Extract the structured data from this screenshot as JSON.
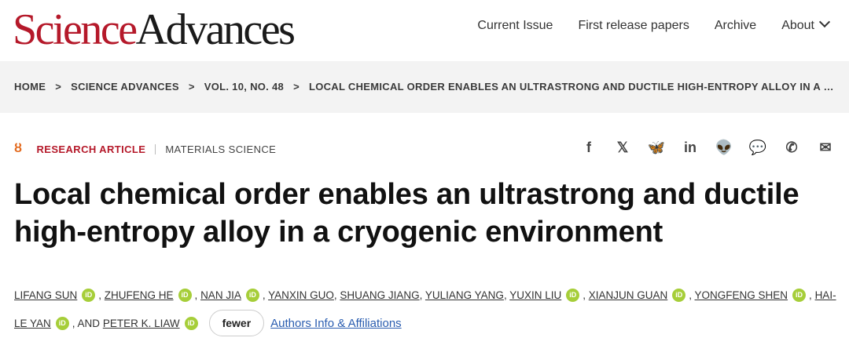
{
  "logo": {
    "science": "Science",
    "advances": "Advances"
  },
  "nav": {
    "current_issue": "Current Issue",
    "first_release": "First release papers",
    "archive": "Archive",
    "about": "About"
  },
  "breadcrumb": {
    "home": "HOME",
    "journal": "SCIENCE ADVANCES",
    "issue": "VOL. 10, NO. 48",
    "article": "LOCAL CHEMICAL ORDER ENABLES AN ULTRASTRONG AND DUCTILE HIGH-ENTROPY ALLOY IN A CRYOGENIC ENVIRONMENT",
    "separator": ">"
  },
  "article": {
    "access_icon": "open-access-icon",
    "type": "RESEARCH ARTICLE",
    "subject": "MATERIALS SCIENCE",
    "title": "Local chemical order enables an ultrastrong and ductile high-entropy alloy in a cryogenic environment"
  },
  "share": [
    {
      "name": "facebook-icon",
      "glyph": "f"
    },
    {
      "name": "x-icon",
      "glyph": "𝕏"
    },
    {
      "name": "bluesky-icon",
      "glyph": "🦋"
    },
    {
      "name": "linkedin-icon",
      "glyph": "in"
    },
    {
      "name": "reddit-icon",
      "glyph": "👽"
    },
    {
      "name": "wechat-icon",
      "glyph": "💬"
    },
    {
      "name": "whatsapp-icon",
      "glyph": "✆"
    },
    {
      "name": "email-icon",
      "glyph": "✉"
    }
  ],
  "authors": [
    {
      "name": "LIFANG SUN",
      "orcid": true,
      "sep": ", "
    },
    {
      "name": "ZHUFENG HE",
      "orcid": true,
      "sep": ", "
    },
    {
      "name": "NAN JIA",
      "orcid": true,
      "sep": ", "
    },
    {
      "name": "YANXIN GUO",
      "orcid": false,
      "sep": ", "
    },
    {
      "name": "SHUANG JIANG",
      "orcid": false,
      "sep": ", "
    },
    {
      "name": "YULIANG YANG",
      "orcid": false,
      "sep": ", "
    },
    {
      "name": "YUXIN LIU",
      "orcid": true,
      "sep": ", "
    },
    {
      "name": "XIANJUN GUAN",
      "orcid": true,
      "sep": ", "
    },
    {
      "name": "YONGFENG SHEN",
      "orcid": true,
      "sep": ", "
    },
    {
      "name": "HAI-LE YAN",
      "orcid": true,
      "sep": ", "
    },
    {
      "name": "PETER K. LIAW",
      "orcid": true,
      "sep": "",
      "prefix": "AND "
    }
  ],
  "orcid_label": "iD",
  "fewer_label": "fewer",
  "affiliations_label": "Authors Info & Affiliations",
  "colors": {
    "brand_red": "#b5192a",
    "orcid_green": "#a6ce39",
    "open_access_orange": "#e36a1e",
    "link_blue": "#2a5db0"
  }
}
